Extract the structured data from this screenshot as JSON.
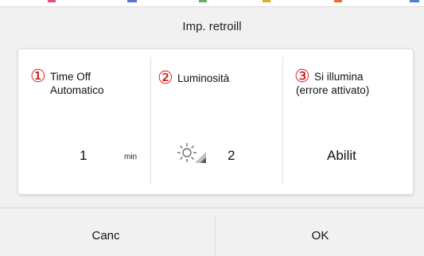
{
  "dialog": {
    "title": "Imp. retroill"
  },
  "settings": [
    {
      "marker": "①",
      "label_line1": "Time Off",
      "label_line2": "Automatico",
      "value": "1",
      "unit": "min"
    },
    {
      "marker": "②",
      "label_line1": "Luminosità",
      "label_line2": "",
      "value": "2",
      "icon": "brightness-sun-icon"
    },
    {
      "marker": "③",
      "label_line1": "Si illumina",
      "label_line2": "(errore attivato)",
      "value": "Abilit"
    }
  ],
  "buttons": {
    "cancel": "Canc",
    "ok": "OK"
  },
  "colors": {
    "marker": "#d01010",
    "background": "#f1f1f1",
    "card": "#ffffff"
  }
}
